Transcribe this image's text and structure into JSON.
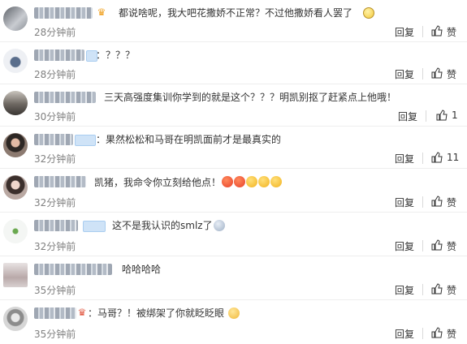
{
  "colors": {
    "text": "#333333",
    "time": "#808080",
    "divider": "#eeeeee"
  },
  "labels": {
    "reply": "回复"
  },
  "comments": [
    {
      "text": "都说啥呢，我大吧花撒娇不正常？不过他撒娇看人罢了",
      "time": "28分钟前",
      "likes": "赞"
    },
    {
      "text": "：？？？",
      "time": "28分钟前",
      "likes": "赞"
    },
    {
      "text": "三天高强度集训你学到的就是这个？？？明凯别抠了赶紧点上他哦！",
      "time": "30分钟前",
      "likes": "1"
    },
    {
      "text": "：果然松松和马哥在明凯面前才是最真实的",
      "time": "32分钟前",
      "likes": "11"
    },
    {
      "text": "凯猪，我命令你立刻给他点！",
      "time": "32分钟前",
      "likes": "赞"
    },
    {
      "text": "这不是我认识的smlz了",
      "time": "32分钟前",
      "likes": "赞"
    },
    {
      "text": "哈哈哈哈",
      "time": "35分钟前",
      "likes": "赞"
    },
    {
      "text": "：马哥？！被绑架了你就眨眨眼",
      "time": "35分钟前",
      "likes": "赞"
    }
  ]
}
